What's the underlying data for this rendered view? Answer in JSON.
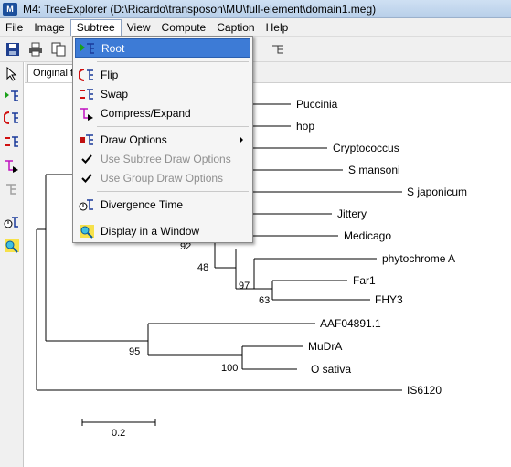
{
  "window": {
    "app_icon_text": "M",
    "title": "M4: TreeExplorer (D:\\Ricardo\\transposon\\MU\\full-element\\domain1.meg)"
  },
  "menubar": {
    "items": [
      "File",
      "Image",
      "Subtree",
      "View",
      "Compute",
      "Caption",
      "Help"
    ],
    "active": "Subtree"
  },
  "tab": {
    "label": "Original tr"
  },
  "subtree_menu": {
    "items": [
      {
        "label": "Root",
        "icon": "root-tree-icon",
        "highlighted": true
      },
      {
        "label": "Flip",
        "icon": "flip-tree-icon"
      },
      {
        "label": "Swap",
        "icon": "swap-tree-icon"
      },
      {
        "label": "Compress/Expand",
        "icon": "compress-expand-icon"
      },
      {
        "label": "Draw Options",
        "icon": "draw-options-icon",
        "submenu": true
      },
      {
        "label": "Use Subtree Draw Options",
        "icon": "checkmark-icon",
        "disabled": true,
        "checked": true
      },
      {
        "label": "Use Group Draw Options",
        "icon": "checkmark-icon",
        "disabled": true,
        "checked": true
      },
      {
        "label": "Divergence Time",
        "icon": "divergence-time-icon"
      },
      {
        "label": "Display in a Window",
        "icon": "display-window-icon"
      }
    ]
  },
  "tree": {
    "taxa": [
      "Puccinia",
      "hop",
      "Cryptococcus",
      "S mansoni",
      "S japonicum",
      "Jittery",
      "Medicago",
      "phytochrome A",
      "Far1",
      "FHY3",
      "AAF04891.1",
      "MuDrA",
      "O sativa",
      "IS6120"
    ],
    "bootstrap_values": [
      "92",
      "48",
      "97",
      "63",
      "95",
      "100"
    ],
    "scale_bar_label": "0.2"
  },
  "colors": {
    "highlight": "#3d7bd6",
    "disabled_text": "#8f8f8f",
    "tree_line": "#000000"
  }
}
